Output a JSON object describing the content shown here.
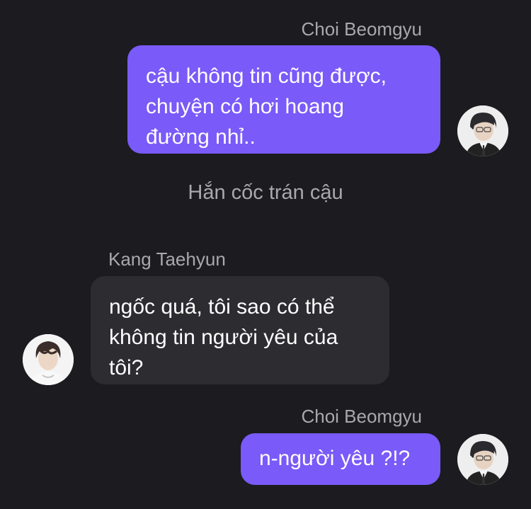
{
  "messages": [
    {
      "sender": "Choi Beomgyu",
      "side": "right",
      "text": "cậu không tin cũng được,\nchuyện có hơi hoang\nđường nhỉ.."
    },
    {
      "narration": "Hắn cốc trán cậu"
    },
    {
      "sender": "Kang Taehyun",
      "side": "left",
      "text": "ngốc quá, tôi sao có thể\nkhông tin người yêu của\ntôi?"
    },
    {
      "sender": "Choi Beomgyu",
      "side": "right",
      "text": "n-người yêu ?!?"
    }
  ],
  "avatars": {
    "beomgyu_icon": "person-photo-icon",
    "taehyun_icon": "person-photo-icon"
  },
  "colors": {
    "background": "#1c1b1f",
    "sent_bubble": "#7a5af8",
    "received_bubble": "#2d2c31",
    "name_text": "#a9a8ad"
  }
}
